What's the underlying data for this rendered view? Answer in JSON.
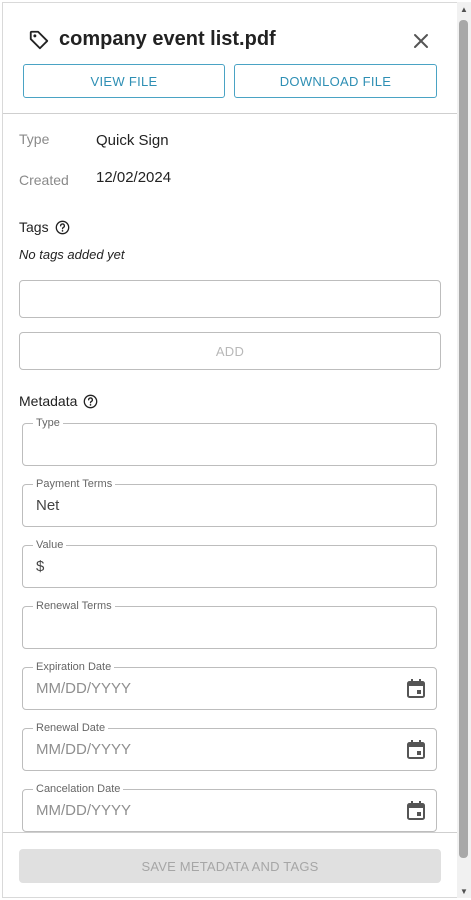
{
  "header": {
    "title": "company event list.pdf",
    "view_button": "VIEW FILE",
    "download_button": "DOWNLOAD FILE"
  },
  "info": {
    "type_label": "Type",
    "type_value": "Quick Sign",
    "created_label": "Created",
    "created_value": "12/02/2024"
  },
  "tags": {
    "label": "Tags",
    "empty_text": "No tags added yet",
    "input_value": "",
    "add_button": "ADD"
  },
  "metadata": {
    "label": "Metadata",
    "fields": [
      {
        "label": "Type",
        "value": ""
      },
      {
        "label": "Payment Terms",
        "value": "Net"
      },
      {
        "label": "Value",
        "value": "$"
      },
      {
        "label": "Renewal Terms",
        "value": ""
      },
      {
        "label": "Expiration Date",
        "placeholder": "MM/DD/YYYY"
      },
      {
        "label": "Renewal Date",
        "placeholder": "MM/DD/YYYY"
      },
      {
        "label": "Cancelation Date",
        "placeholder": "MM/DD/YYYY"
      }
    ]
  },
  "footer": {
    "save_button": "SAVE METADATA AND TAGS"
  },
  "icons": {
    "title": "tag-icon",
    "close": "close-icon",
    "help": "help-circle-icon",
    "date": "calendar-icon"
  },
  "colors": {
    "accent": "#2e8fb4",
    "border": "#bdbdbd",
    "disabled_bg": "#e0e0e0"
  }
}
